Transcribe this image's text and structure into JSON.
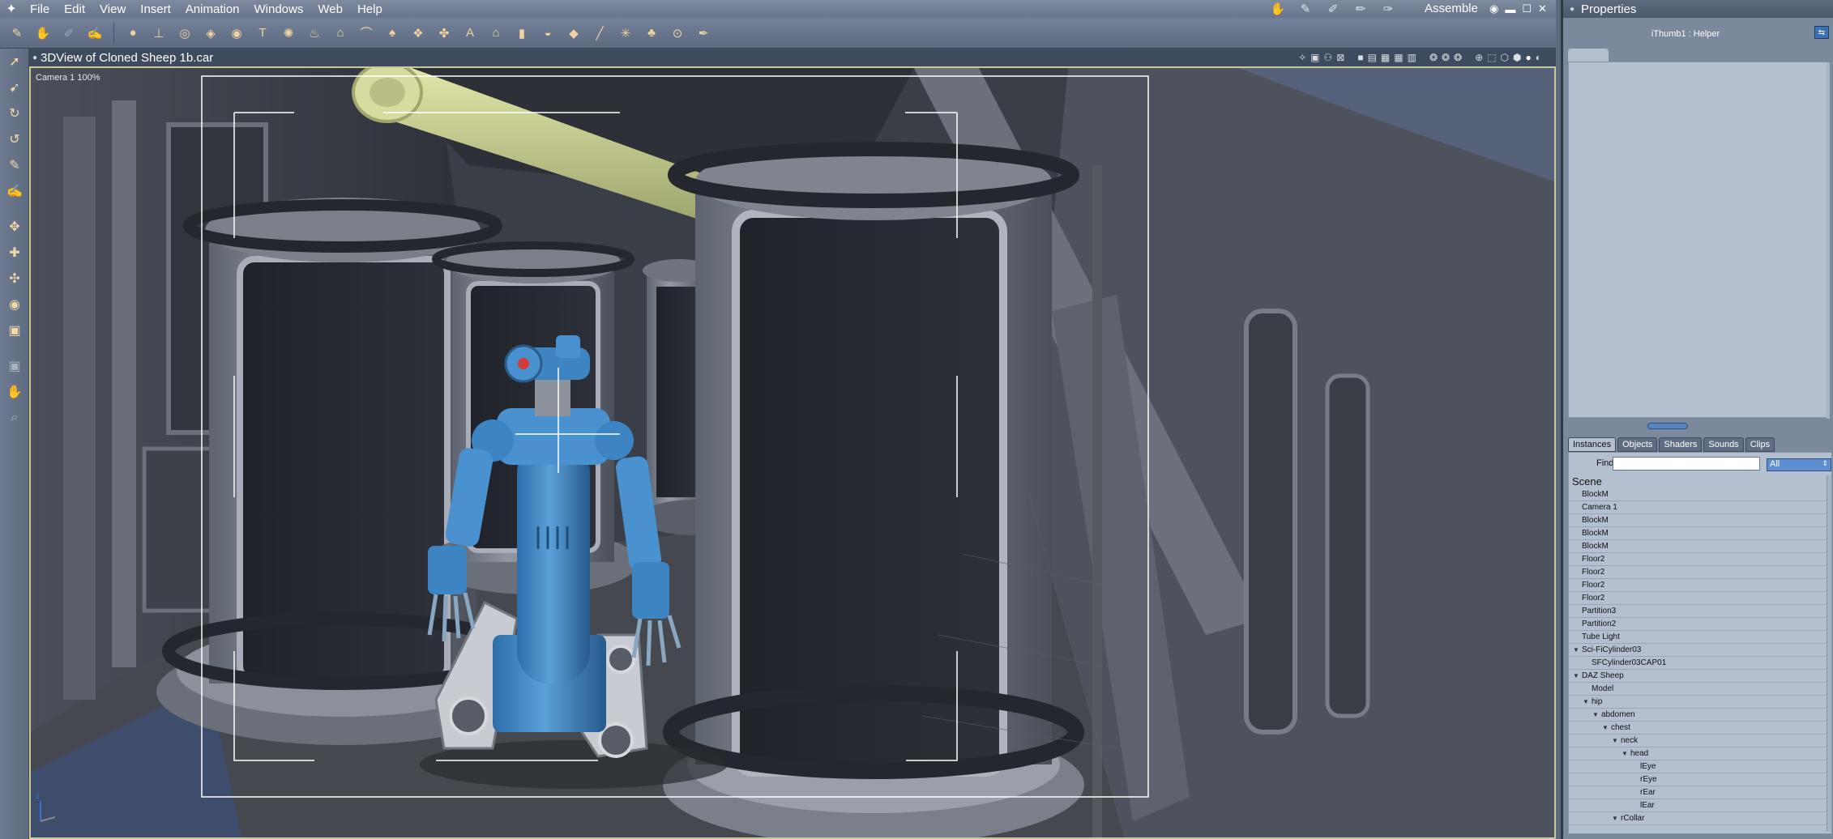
{
  "menubar": {
    "items": [
      "File",
      "Edit",
      "View",
      "Insert",
      "Animation",
      "Windows",
      "Web",
      "Help"
    ]
  },
  "toolbar": {
    "tools": [
      "brush-tool",
      "hand-tool",
      "sculpt-tool",
      "paint-tool",
      "sphere-prim",
      "anvil-prim",
      "torus-prim",
      "cube-prim",
      "disc-prim",
      "text-prim",
      "gear-prim",
      "bolt-prim",
      "lathe-prim",
      "spline-prim",
      "hat-prim",
      "bowl-prim",
      "puzzle-prim",
      "wheel-prim",
      "text3d-prim",
      "house-prim",
      "cylinder-prim",
      "boat-prim",
      "stone-prim",
      "pen-prim",
      "grass-prim",
      "tree-prim",
      "target-prim",
      "wrench-prim"
    ]
  },
  "rooms": {
    "current": "Assemble"
  },
  "viewport": {
    "title": "3DView of Cloned Sheep 1b.car",
    "camera_label": "Camera 1 100%"
  },
  "panel": {
    "title": "Properties",
    "helper_label": "iThumb1 : Helper"
  },
  "instances": {
    "tabs": [
      "Instances",
      "Objects",
      "Shaders",
      "Sounds",
      "Clips"
    ],
    "find_label": "Find",
    "find_value": "",
    "filter_value": "All",
    "scene_label": "Scene",
    "rows": [
      {
        "label": "BlockM",
        "depth": 0,
        "open": false
      },
      {
        "label": "Camera 1",
        "depth": 0,
        "open": false
      },
      {
        "label": "BlockM",
        "depth": 0,
        "open": false
      },
      {
        "label": "BlockM",
        "depth": 0,
        "open": false
      },
      {
        "label": "BlockM",
        "depth": 0,
        "open": false
      },
      {
        "label": "Floor2",
        "depth": 0,
        "open": false
      },
      {
        "label": "Floor2",
        "depth": 0,
        "open": false
      },
      {
        "label": "Floor2",
        "depth": 0,
        "open": false
      },
      {
        "label": "Floor2",
        "depth": 0,
        "open": false
      },
      {
        "label": "Partition3",
        "depth": 0,
        "open": false
      },
      {
        "label": "Partition2",
        "depth": 0,
        "open": false
      },
      {
        "label": "Tube Light",
        "depth": 0,
        "open": false
      },
      {
        "label": "Sci-FiCylinder03",
        "depth": 0,
        "open": true
      },
      {
        "label": "SFCylinder03CAP01",
        "depth": 1,
        "open": false
      },
      {
        "label": "DAZ Sheep",
        "depth": 0,
        "open": true
      },
      {
        "label": "Model",
        "depth": 1,
        "open": false
      },
      {
        "label": "hip",
        "depth": 1,
        "open": true
      },
      {
        "label": "abdomen",
        "depth": 2,
        "open": true
      },
      {
        "label": "chest",
        "depth": 3,
        "open": true
      },
      {
        "label": "neck",
        "depth": 4,
        "open": true
      },
      {
        "label": "head",
        "depth": 5,
        "open": true
      },
      {
        "label": "lEye",
        "depth": 6,
        "open": false
      },
      {
        "label": "rEye",
        "depth": 6,
        "open": false
      },
      {
        "label": "rEar",
        "depth": 6,
        "open": false
      },
      {
        "label": "lEar",
        "depth": 6,
        "open": false
      },
      {
        "label": "rCollar",
        "depth": 4,
        "open": true
      }
    ]
  },
  "colors": {
    "chrome": "#6d7a90",
    "viewport_border": "#c8c99a",
    "robot_blue": "#3f86c4",
    "tube_light": "#c9cf8a",
    "panel_bg": "#b4bfd0"
  }
}
